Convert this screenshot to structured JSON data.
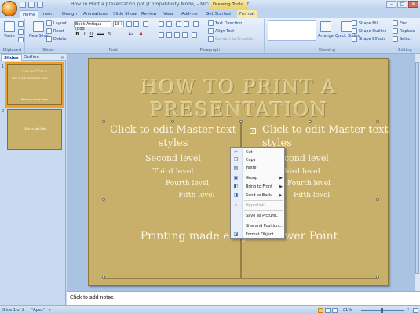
{
  "window": {
    "title": "How To Print a presentation.ppt [Compatibility Mode] - Microsoft PowerPoint",
    "context_tab": "Drawing Tools",
    "controls": [
      "–",
      "□",
      "✕"
    ]
  },
  "ribbon_tabs": [
    "Home",
    "Insert",
    "Design",
    "Animations",
    "Slide Show",
    "Review",
    "View",
    "Add-Ins",
    "Get Started",
    "Format"
  ],
  "ribbon": {
    "clipboard": {
      "label": "Clipboard",
      "paste": "Paste"
    },
    "slides": {
      "label": "Slides",
      "new_slide": "New Slide",
      "layout": "Layout",
      "reset": "Reset",
      "delete": "Delete"
    },
    "font": {
      "label": "Font",
      "family": "Book Antiqua (Bod",
      "size": "18+",
      "bold": "B",
      "italic": "I",
      "underline": "U",
      "strike": "abc",
      "shadow": "S",
      "color": "A",
      "case": "Aa"
    },
    "paragraph": {
      "label": "Paragraph",
      "text_direction": "Text Direction",
      "align_text": "Align Text",
      "smartart": "Convert to SmartArt"
    },
    "drawing": {
      "label": "Drawing",
      "arrange": "Arrange",
      "quick_styles": "Quick Styles",
      "shape_fill": "Shape Fill",
      "shape_outline": "Shape Outline",
      "shape_effects": "Shape Effects"
    },
    "editing": {
      "label": "Editing",
      "find": "Find",
      "replace": "Replace",
      "select": "Select"
    }
  },
  "panel": {
    "tabs": [
      "Slides",
      "Outline"
    ],
    "close": "×",
    "slide_numbers": [
      "1",
      "2"
    ],
    "thumb1": {
      "title": "How to Print a",
      "body": "Click to edit Master text styles",
      "footer": "Printing made easy"
    },
    "thumb2": {
      "text": "Click to add title"
    }
  },
  "slide": {
    "title": "HOW TO PRINT A PRESENTATION",
    "left": {
      "l1": "Click to edit Master text",
      "l1b": "styles",
      "l2": "Second level",
      "l3": "Third level",
      "l4": "Fourth level",
      "l5": "Fifth level"
    },
    "right": {
      "l1": "Click to edit Master text",
      "l1b": "styles",
      "l2": "Second level",
      "l3": "Third level",
      "l4": "Fourth level",
      "l5": "Fifth level"
    },
    "subtitle": "Printing made easy for Power Point"
  },
  "context_menu": {
    "items": [
      "Cut",
      "Copy",
      "Paste",
      "Group",
      "Bring to Front",
      "Send to Back",
      "Hyperlink...",
      "Save as Picture...",
      "Size and Position...",
      "Format Object..."
    ],
    "submenu_arrow": "▶"
  },
  "notes": {
    "placeholder": "Click to add notes"
  },
  "status": {
    "slide": "Slide 1 of 2",
    "theme": "\"Apex\"",
    "zoom": "81%"
  }
}
